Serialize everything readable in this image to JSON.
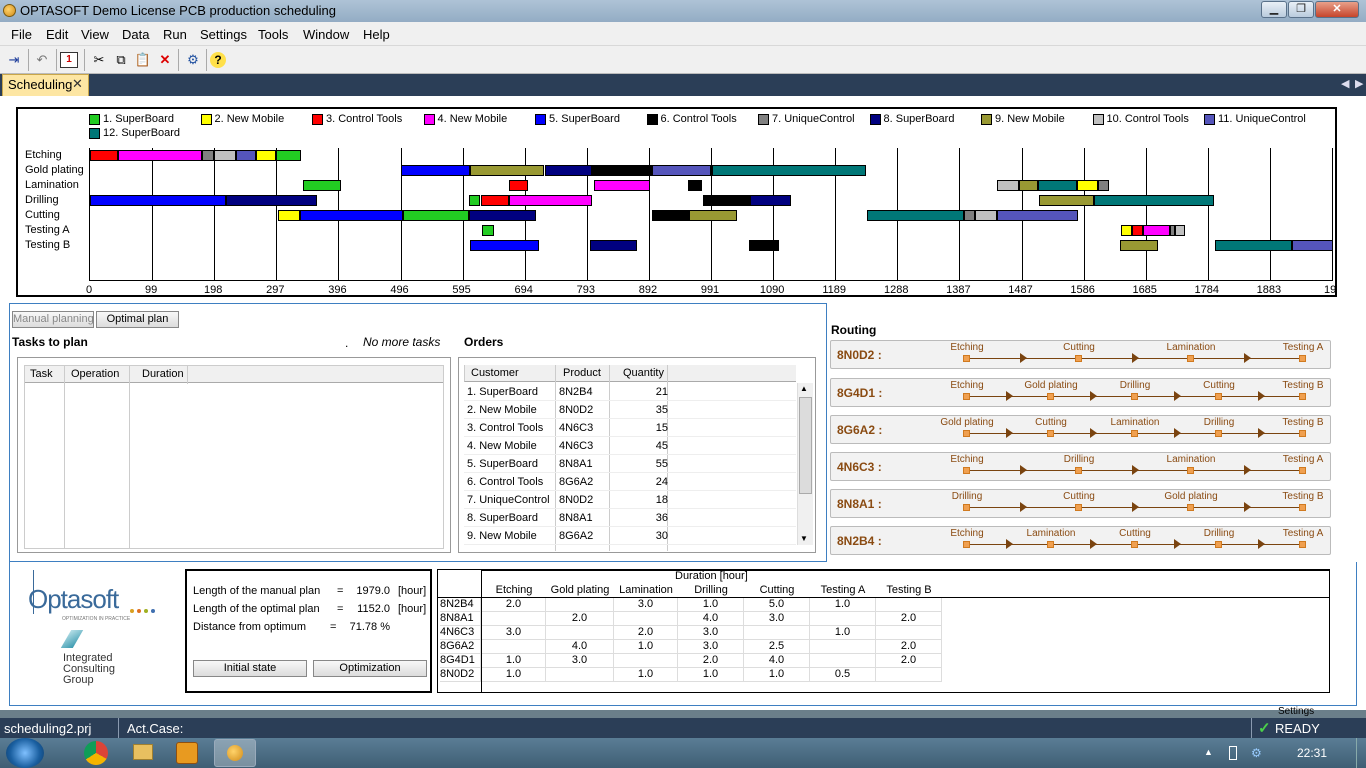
{
  "window": {
    "title": "OPTASOFT Demo License PCB production scheduling",
    "min": "▁",
    "max": "❐",
    "close": "✕"
  },
  "menu": [
    "File",
    "Edit",
    "View",
    "Data",
    "Run",
    "Settings",
    "Tools",
    "Window",
    "Help"
  ],
  "toolbar": {
    "icons": [
      "pin-icon",
      "undo-icon",
      "calendar-icon",
      "cut-icon",
      "copy-icon",
      "paste-icon",
      "delete-icon",
      "settings-icon",
      "help-icon"
    ],
    "calendar_label": "1",
    "help_label": "?"
  },
  "tab": {
    "label": "Scheduling",
    "close": "✕"
  },
  "gantt": {
    "legend": [
      {
        "label": "1. SuperBoard",
        "color": "#22cc22"
      },
      {
        "label": "2. New Mobile",
        "color": "#ffff00"
      },
      {
        "label": "3. Control Tools",
        "color": "#ff0000"
      },
      {
        "label": "4. New Mobile",
        "color": "#ff00ff"
      },
      {
        "label": "5. SuperBoard",
        "color": "#0000ff"
      },
      {
        "label": "6. Control Tools",
        "color": "#000000"
      },
      {
        "label": "7. UniqueControl",
        "color": "#808080"
      },
      {
        "label": "8. SuperBoard",
        "color": "#000080"
      },
      {
        "label": "9. New Mobile",
        "color": "#999933"
      },
      {
        "label": "10. Control Tools",
        "color": "#c0c0c0"
      },
      {
        "label": "11. UniqueControl",
        "color": "#5555bb"
      },
      {
        "label": "12. SuperBoard",
        "color": "#007777"
      }
    ],
    "rows": [
      "Etching",
      "Gold plating",
      "Lamination",
      "Drilling",
      "Cutting",
      "Testing A",
      "Testing B"
    ],
    "ticks": [
      "0",
      "99",
      "198",
      "297",
      "396",
      "496",
      "595",
      "694",
      "793",
      "892",
      "991",
      "1090",
      "1189",
      "1288",
      "1387",
      "1487",
      "1586",
      "1685",
      "1784",
      "1883",
      "19"
    ],
    "max": 1980,
    "tasks": [
      {
        "r": 0,
        "s": 0,
        "e": 44,
        "o": 3
      },
      {
        "r": 0,
        "s": 44,
        "e": 178,
        "o": 4
      },
      {
        "r": 0,
        "s": 178,
        "e": 198,
        "o": 7
      },
      {
        "r": 0,
        "s": 198,
        "e": 232,
        "o": 10
      },
      {
        "r": 0,
        "s": 232,
        "e": 264,
        "o": 11
      },
      {
        "r": 0,
        "s": 264,
        "e": 297,
        "o": 2
      },
      {
        "r": 0,
        "s": 297,
        "e": 337,
        "o": 1
      },
      {
        "r": 1,
        "s": 496,
        "e": 606,
        "o": 5
      },
      {
        "r": 1,
        "s": 606,
        "e": 724,
        "o": 9
      },
      {
        "r": 1,
        "s": 724,
        "e": 800,
        "o": 8
      },
      {
        "r": 1,
        "s": 800,
        "e": 895,
        "o": 6
      },
      {
        "r": 1,
        "s": 895,
        "e": 990,
        "o": 11
      },
      {
        "r": 1,
        "s": 990,
        "e": 1236,
        "o": 12
      },
      {
        "r": 2,
        "s": 339,
        "e": 400,
        "o": 1
      },
      {
        "r": 2,
        "s": 668,
        "e": 697,
        "o": 3
      },
      {
        "r": 2,
        "s": 803,
        "e": 892,
        "o": 4
      },
      {
        "r": 2,
        "s": 952,
        "e": 975,
        "o": 6
      },
      {
        "r": 2,
        "s": 1445,
        "e": 1480,
        "o": 10
      },
      {
        "r": 2,
        "s": 1480,
        "e": 1510,
        "o": 9
      },
      {
        "r": 2,
        "s": 1510,
        "e": 1572,
        "o": 12
      },
      {
        "r": 2,
        "s": 1572,
        "e": 1606,
        "o": 2
      },
      {
        "r": 2,
        "s": 1606,
        "e": 1624,
        "o": 7
      },
      {
        "r": 3,
        "s": 0,
        "e": 217,
        "o": 5
      },
      {
        "r": 3,
        "s": 217,
        "e": 362,
        "o": 8
      },
      {
        "r": 3,
        "s": 603,
        "e": 622,
        "o": 1
      },
      {
        "r": 3,
        "s": 622,
        "e": 667,
        "o": 3
      },
      {
        "r": 3,
        "s": 667,
        "e": 800,
        "o": 4
      },
      {
        "r": 3,
        "s": 977,
        "e": 1052,
        "o": 6
      },
      {
        "r": 3,
        "s": 1052,
        "e": 1116,
        "o": 8
      },
      {
        "r": 3,
        "s": 1511,
        "e": 1600,
        "o": 9
      },
      {
        "r": 3,
        "s": 1600,
        "e": 1790,
        "o": 12
      },
      {
        "r": 4,
        "s": 300,
        "e": 334,
        "o": 2
      },
      {
        "r": 4,
        "s": 334,
        "e": 499,
        "o": 5
      },
      {
        "r": 4,
        "s": 499,
        "e": 603,
        "o": 1
      },
      {
        "r": 4,
        "s": 603,
        "e": 711,
        "o": 8
      },
      {
        "r": 4,
        "s": 895,
        "e": 954,
        "o": 6
      },
      {
        "r": 4,
        "s": 954,
        "e": 1030,
        "o": 9
      },
      {
        "r": 4,
        "s": 1238,
        "e": 1392,
        "o": 12
      },
      {
        "r": 4,
        "s": 1392,
        "e": 1410,
        "o": 7
      },
      {
        "r": 4,
        "s": 1410,
        "e": 1445,
        "o": 10
      },
      {
        "r": 4,
        "s": 1445,
        "e": 1574,
        "o": 11
      },
      {
        "r": 5,
        "s": 624,
        "e": 643,
        "o": 1
      },
      {
        "r": 5,
        "s": 1642,
        "e": 1660,
        "o": 2
      },
      {
        "r": 5,
        "s": 1660,
        "e": 1678,
        "o": 3
      },
      {
        "r": 5,
        "s": 1678,
        "e": 1720,
        "o": 4
      },
      {
        "r": 5,
        "s": 1720,
        "e": 1728,
        "o": 7
      },
      {
        "r": 5,
        "s": 1728,
        "e": 1745,
        "o": 10
      },
      {
        "r": 6,
        "s": 606,
        "e": 716,
        "o": 5
      },
      {
        "r": 6,
        "s": 797,
        "e": 872,
        "o": 8
      },
      {
        "r": 6,
        "s": 1050,
        "e": 1097,
        "o": 6
      },
      {
        "r": 6,
        "s": 1640,
        "e": 1701,
        "o": 9
      },
      {
        "r": 6,
        "s": 1792,
        "e": 1915,
        "o": 12
      },
      {
        "r": 6,
        "s": 1915,
        "e": 1980,
        "o": 11
      }
    ]
  },
  "planning": {
    "manual_label": "Manual planning",
    "optimal_label": "Optimal plan",
    "tasks_title": "Tasks to plan",
    "dot": ".",
    "no_more": "No more tasks",
    "task_cols": [
      "Task",
      "Operation",
      "Duration"
    ]
  },
  "orders": {
    "title": "Orders",
    "cols": [
      "Customer",
      "Product",
      "Quantity"
    ],
    "rows": [
      [
        "1. SuperBoard",
        "8N2B4",
        "21"
      ],
      [
        "2. New Mobile",
        "8N0D2",
        "35"
      ],
      [
        "3. Control Tools",
        "4N6C3",
        "15"
      ],
      [
        "4. New Mobile",
        "4N6C3",
        "45"
      ],
      [
        "5. SuperBoard",
        "8N8A1",
        "55"
      ],
      [
        "6. Control Tools",
        "8G6A2",
        "24"
      ],
      [
        "7. UniqueControl",
        "8N0D2",
        "18"
      ],
      [
        "8. SuperBoard",
        "8N8A1",
        "36"
      ],
      [
        "9. New Mobile",
        "8G6A2",
        "30"
      ]
    ]
  },
  "routing": {
    "title": "Routing",
    "items": [
      {
        "name": "8N0D2 :",
        "steps": [
          "Etching",
          "Cutting",
          "Lamination",
          "Testing A"
        ]
      },
      {
        "name": "8G4D1 :",
        "steps": [
          "Etching",
          "Gold plating",
          "Drilling",
          "Cutting",
          "Testing B"
        ]
      },
      {
        "name": "8G6A2 :",
        "steps": [
          "Gold plating",
          "Cutting",
          "Lamination",
          "Drilling",
          "Testing B"
        ]
      },
      {
        "name": "4N6C3 :",
        "steps": [
          "Etching",
          "Drilling",
          "Lamination",
          "Testing A"
        ]
      },
      {
        "name": "8N8A1 :",
        "steps": [
          "Drilling",
          "Cutting",
          "Gold plating",
          "Testing B"
        ]
      },
      {
        "name": "8N2B4 :",
        "steps": [
          "Etching",
          "Lamination",
          "Cutting",
          "Drilling",
          "Testing A"
        ]
      }
    ]
  },
  "logo": {
    "name": "Optasoft",
    "tagline": "OPTIMIZATION IN PRACTICE",
    "partner": [
      "Integrated",
      "Consulting",
      "Group"
    ]
  },
  "summary": {
    "rows": [
      [
        "Length of the manual plan",
        "=",
        "1979.0",
        "[hour]"
      ],
      [
        "Length of the optimal plan",
        "=",
        "1152.0",
        "[hour]"
      ],
      [
        "Distance from optimum",
        "=",
        "71.78 %",
        ""
      ]
    ],
    "initial_button": "Initial state",
    "optimization_button": "Optimization"
  },
  "duration": {
    "title": "Duration [hour]",
    "cols": [
      "Etching",
      "Gold plating",
      "Lamination",
      "Drilling",
      "Cutting",
      "Testing A",
      "Testing B"
    ],
    "rows": [
      [
        "8N2B4",
        "2.0",
        "",
        "3.0",
        "1.0",
        "5.0",
        "1.0",
        ""
      ],
      [
        "8N8A1",
        "",
        "2.0",
        "",
        "4.0",
        "3.0",
        "",
        "2.0"
      ],
      [
        "4N6C3",
        "3.0",
        "",
        "2.0",
        "3.0",
        "",
        "1.0",
        ""
      ],
      [
        "8G6A2",
        "",
        "4.0",
        "1.0",
        "3.0",
        "2.5",
        "",
        "2.0"
      ],
      [
        "8G4D1",
        "1.0",
        "3.0",
        "",
        "2.0",
        "4.0",
        "",
        "2.0"
      ],
      [
        "8N0D2",
        "1.0",
        "",
        "1.0",
        "1.0",
        "1.0",
        "0.5",
        ""
      ]
    ]
  },
  "settings_label": "Settings",
  "status": {
    "project": "scheduling2.prj",
    "act_case": "Act.Case:",
    "ready": "READY",
    "check": "✓"
  },
  "taskbar": {
    "time": "22:31"
  }
}
